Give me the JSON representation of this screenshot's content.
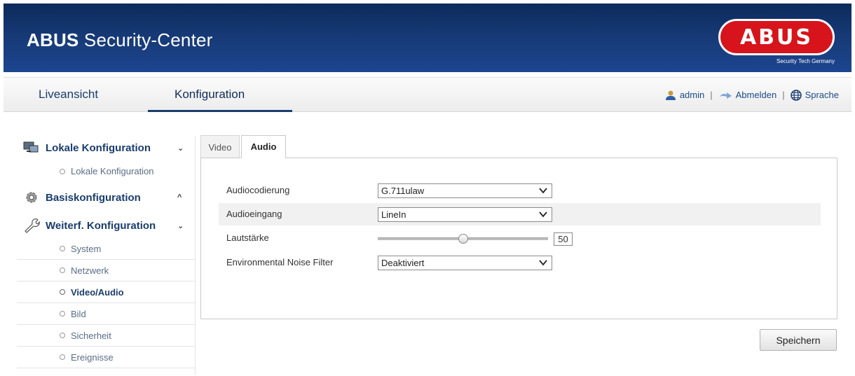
{
  "header": {
    "title_bold": "ABUS",
    "title_rest": " Security-Center",
    "logo_text": "ABUS",
    "logo_subtitle": "Security Tech Germany",
    "colors": {
      "background": "#183c7a",
      "logo_red": "#d7141b"
    }
  },
  "nav": {
    "tabs": [
      {
        "label": "Liveansicht",
        "active": false
      },
      {
        "label": "Konfiguration",
        "active": true
      }
    ],
    "user": "admin",
    "logout": "Abmelden",
    "language": "Sprache",
    "icons": [
      "user-icon",
      "logout-icon",
      "globe-icon"
    ]
  },
  "sidebar": {
    "sections": [
      {
        "label": "Lokale Konfiguration",
        "icon": "monitor-icon",
        "chevron": "⌄",
        "items": [
          "Lokale Konfiguration"
        ]
      },
      {
        "label": "Basiskonfiguration",
        "icon": "gear-icon",
        "chevron": "^",
        "items": []
      },
      {
        "label": "Weiterf. Konfiguration",
        "icon": "wrench-icon",
        "chevron": "⌄",
        "items": [
          "System",
          "Netzwerk",
          "Video/Audio",
          "Bild",
          "Sicherheit",
          "Ereignisse"
        ]
      }
    ],
    "active_item": "Video/Audio"
  },
  "subtabs": [
    {
      "label": "Video",
      "active": false
    },
    {
      "label": "Audio",
      "active": true
    }
  ],
  "form": {
    "audio_encoding": {
      "label": "Audiocodierung",
      "value": "G.711ulaw"
    },
    "audio_input": {
      "label": "Audioeingang",
      "value": "LineIn"
    },
    "volume": {
      "label": "Lautstärke",
      "value": "50",
      "fraction": 0.5
    },
    "noise_filter": {
      "label": "Environmental Noise Filter",
      "value": "Deaktiviert"
    }
  },
  "save_label": "Speichern"
}
